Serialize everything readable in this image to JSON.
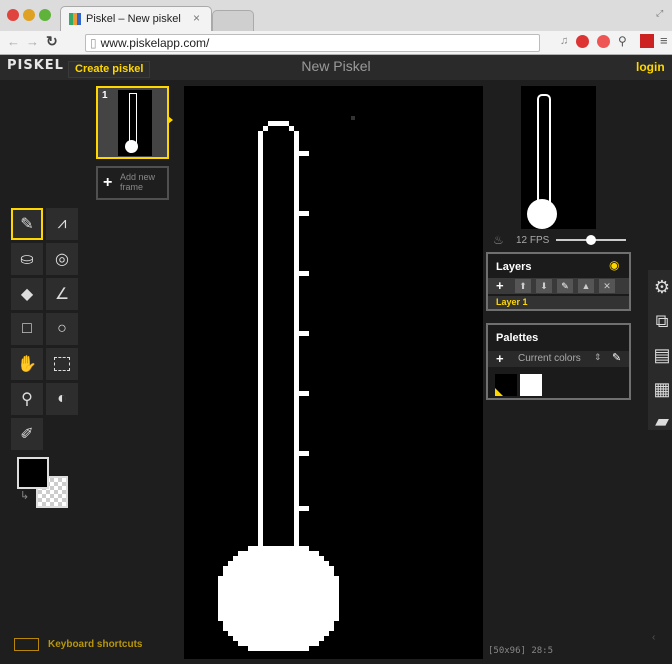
{
  "browser": {
    "tab_title": "Piskel – New piskel",
    "url": "www.piskelapp.com/"
  },
  "header": {
    "logo": "PISKEL",
    "create_label": "Create piskel",
    "title": "New Piskel",
    "login_label": "login"
  },
  "frames": {
    "frame_number": "1",
    "add_frame_label": "Add new frame"
  },
  "preview": {
    "fps_label": "12 FPS",
    "fps_fraction": 0.55
  },
  "layers": {
    "title": "Layers",
    "items": [
      "Layer 1"
    ]
  },
  "palettes": {
    "title": "Palettes",
    "current": "Current colors",
    "swatches": [
      "#000000",
      "#ffffff"
    ]
  },
  "colors": {
    "primary": "#000000",
    "secondary": "transparent",
    "accent": "#ffd700"
  },
  "tools": [
    "pen-icon",
    "vertical-mirror-icon",
    "paint-bucket-icon",
    "paint-all-icon",
    "eraser-icon",
    "stroke-icon",
    "rectangle-icon",
    "circle-icon",
    "move-icon",
    "rect-select-icon",
    "magic-wand-icon",
    "lighten-icon",
    "color-picker-icon"
  ],
  "footer": {
    "shortcuts_label": "Keyboard shortcuts",
    "coords": "[50x96] 28:5"
  }
}
